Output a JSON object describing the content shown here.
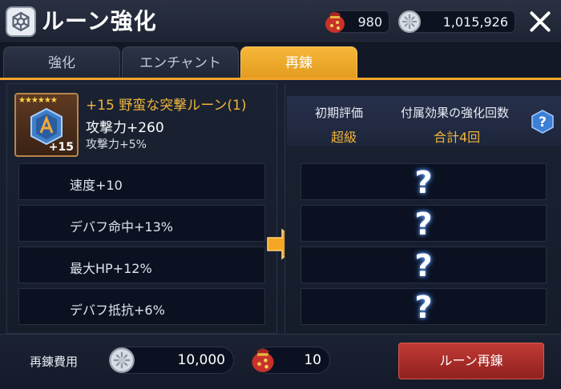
{
  "header": {
    "title": "ルーン強化",
    "resource_bag_value": "980",
    "resource_coin_value": "1,015,926",
    "icons": [
      "settings-icon",
      "pouch-icon",
      "coin-icon",
      "close-icon"
    ]
  },
  "tabs": [
    {
      "label": "強化",
      "active": false
    },
    {
      "label": "エンチャント",
      "active": false
    },
    {
      "label": "再錬",
      "active": true
    }
  ],
  "rune": {
    "stars": "★★★★★★",
    "level_badge": "+15",
    "name": "+15 野蛮な突撃ルーン(1)",
    "main_stat": "攻撃力+260",
    "sub_stat": "攻撃力+5%"
  },
  "current_stats": [
    "速度+10",
    "デバフ命中+13%",
    "最大HP+12%",
    "デバフ抵抗+6%"
  ],
  "result": {
    "initial_grade_label": "初期評価",
    "initial_grade_value": "超級",
    "enhance_count_label": "付属効果の強化回数",
    "enhance_count_value": "合計4回",
    "unknown_rows": [
      "?",
      "?",
      "?",
      "?"
    ]
  },
  "footer": {
    "cost_label": "再錬費用",
    "coin_cost": "10,000",
    "bag_cost": "10",
    "reforge_button": "ルーン再錬"
  },
  "colors": {
    "accent_gold": "#f2b53a",
    "active_tab": "#f0a52a",
    "button_red": "#b3302c"
  }
}
